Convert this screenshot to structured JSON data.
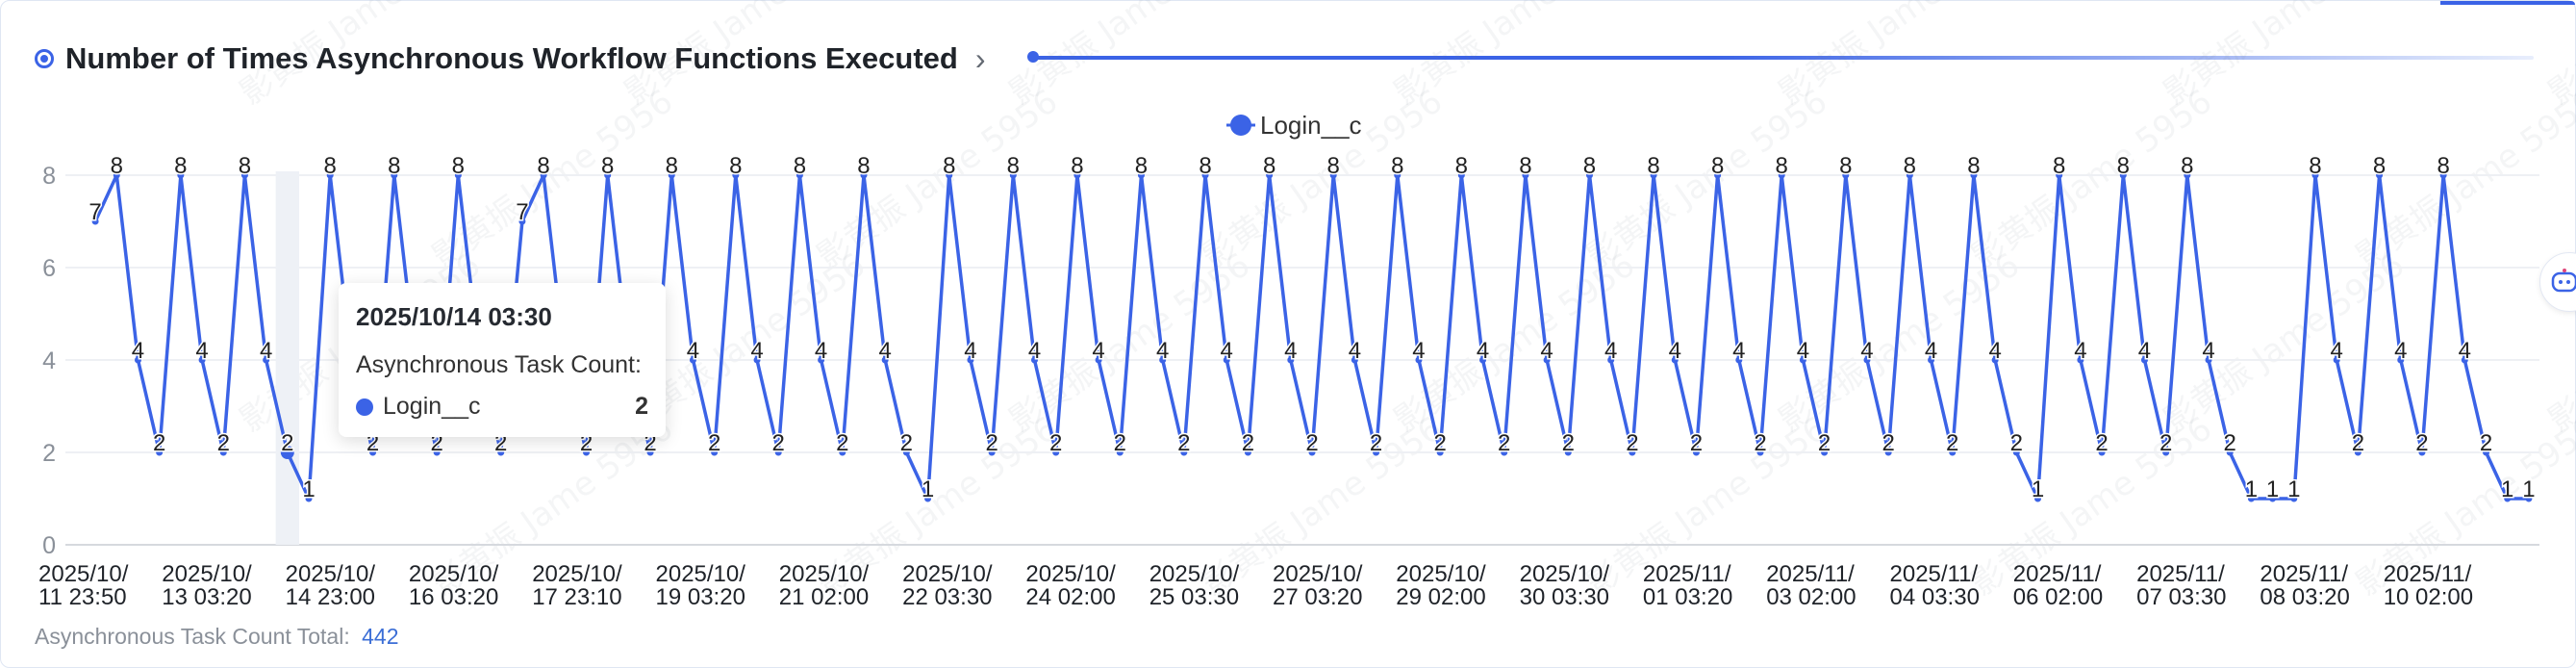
{
  "header": {
    "title": "Number of Times Asynchronous Workflow Functions Executed"
  },
  "icons": {
    "title": "target-icon",
    "expand": "chevron-right-icon",
    "side": "robot-icon"
  },
  "colors": {
    "accent": "#3b63e6",
    "line": "#3b63e6",
    "grid": "#eef0f4",
    "axis_text": "#1f2329"
  },
  "tooltip": {
    "title": "2025/10/14 03:30",
    "subtitle": "Asynchronous Task Count:",
    "series": "Login__c",
    "value": "2"
  },
  "footer": {
    "label": "Asynchronous Task Count Total:",
    "value": "442"
  },
  "watermark": "影黄振 Jame 5956",
  "chart_data": {
    "type": "line",
    "legend": [
      "Login__c"
    ],
    "legend_position": "top-center",
    "grid": true,
    "ylim": [
      0,
      8
    ],
    "y_ticks": [
      0,
      2,
      4,
      6,
      8
    ],
    "x_tick_labels": [
      [
        "2025/10/",
        "11 23:50"
      ],
      [
        "2025/10/",
        "13 03:20"
      ],
      [
        "2025/10/",
        "14 23:00"
      ],
      [
        "2025/10/",
        "16 03:20"
      ],
      [
        "2025/10/",
        "17 23:10"
      ],
      [
        "2025/10/",
        "19 03:20"
      ],
      [
        "2025/10/",
        "21 02:00"
      ],
      [
        "2025/10/",
        "22 03:30"
      ],
      [
        "2025/10/",
        "24 02:00"
      ],
      [
        "2025/10/",
        "25 03:30"
      ],
      [
        "2025/10/",
        "27 03:20"
      ],
      [
        "2025/10/",
        "29 02:00"
      ],
      [
        "2025/10/",
        "30 03:30"
      ],
      [
        "2025/11/",
        "01 03:20"
      ],
      [
        "2025/11/",
        "03 02:00"
      ],
      [
        "2025/11/",
        "04 03:30"
      ],
      [
        "2025/11/",
        "06 02:00"
      ],
      [
        "2025/11/",
        "07 03:30"
      ],
      [
        "2025/11/",
        "08 03:20"
      ],
      [
        "2025/11/",
        "10 02:00"
      ]
    ],
    "series": [
      {
        "name": "Login__c",
        "values": [
          7,
          8,
          4,
          2,
          8,
          4,
          2,
          8,
          4,
          2,
          1,
          8,
          4,
          2,
          8,
          4,
          2,
          8,
          4,
          2,
          7,
          8,
          4,
          2,
          8,
          4,
          2,
          8,
          4,
          2,
          8,
          4,
          2,
          8,
          4,
          2,
          8,
          4,
          2,
          1,
          8,
          4,
          2,
          8,
          4,
          2,
          8,
          4,
          2,
          8,
          4,
          2,
          8,
          4,
          2,
          8,
          4,
          2,
          8,
          4,
          2,
          8,
          4,
          2,
          8,
          4,
          2,
          8,
          4,
          2,
          8,
          4,
          2,
          8,
          4,
          2,
          8,
          4,
          2,
          8,
          4,
          2,
          8,
          4,
          2,
          8,
          4,
          2,
          8,
          4,
          2,
          1,
          8,
          4,
          2,
          8,
          4,
          2,
          8,
          4,
          2,
          1,
          1,
          1,
          8,
          4,
          2,
          8,
          4,
          2,
          8,
          4,
          2,
          1,
          1
        ]
      }
    ]
  }
}
